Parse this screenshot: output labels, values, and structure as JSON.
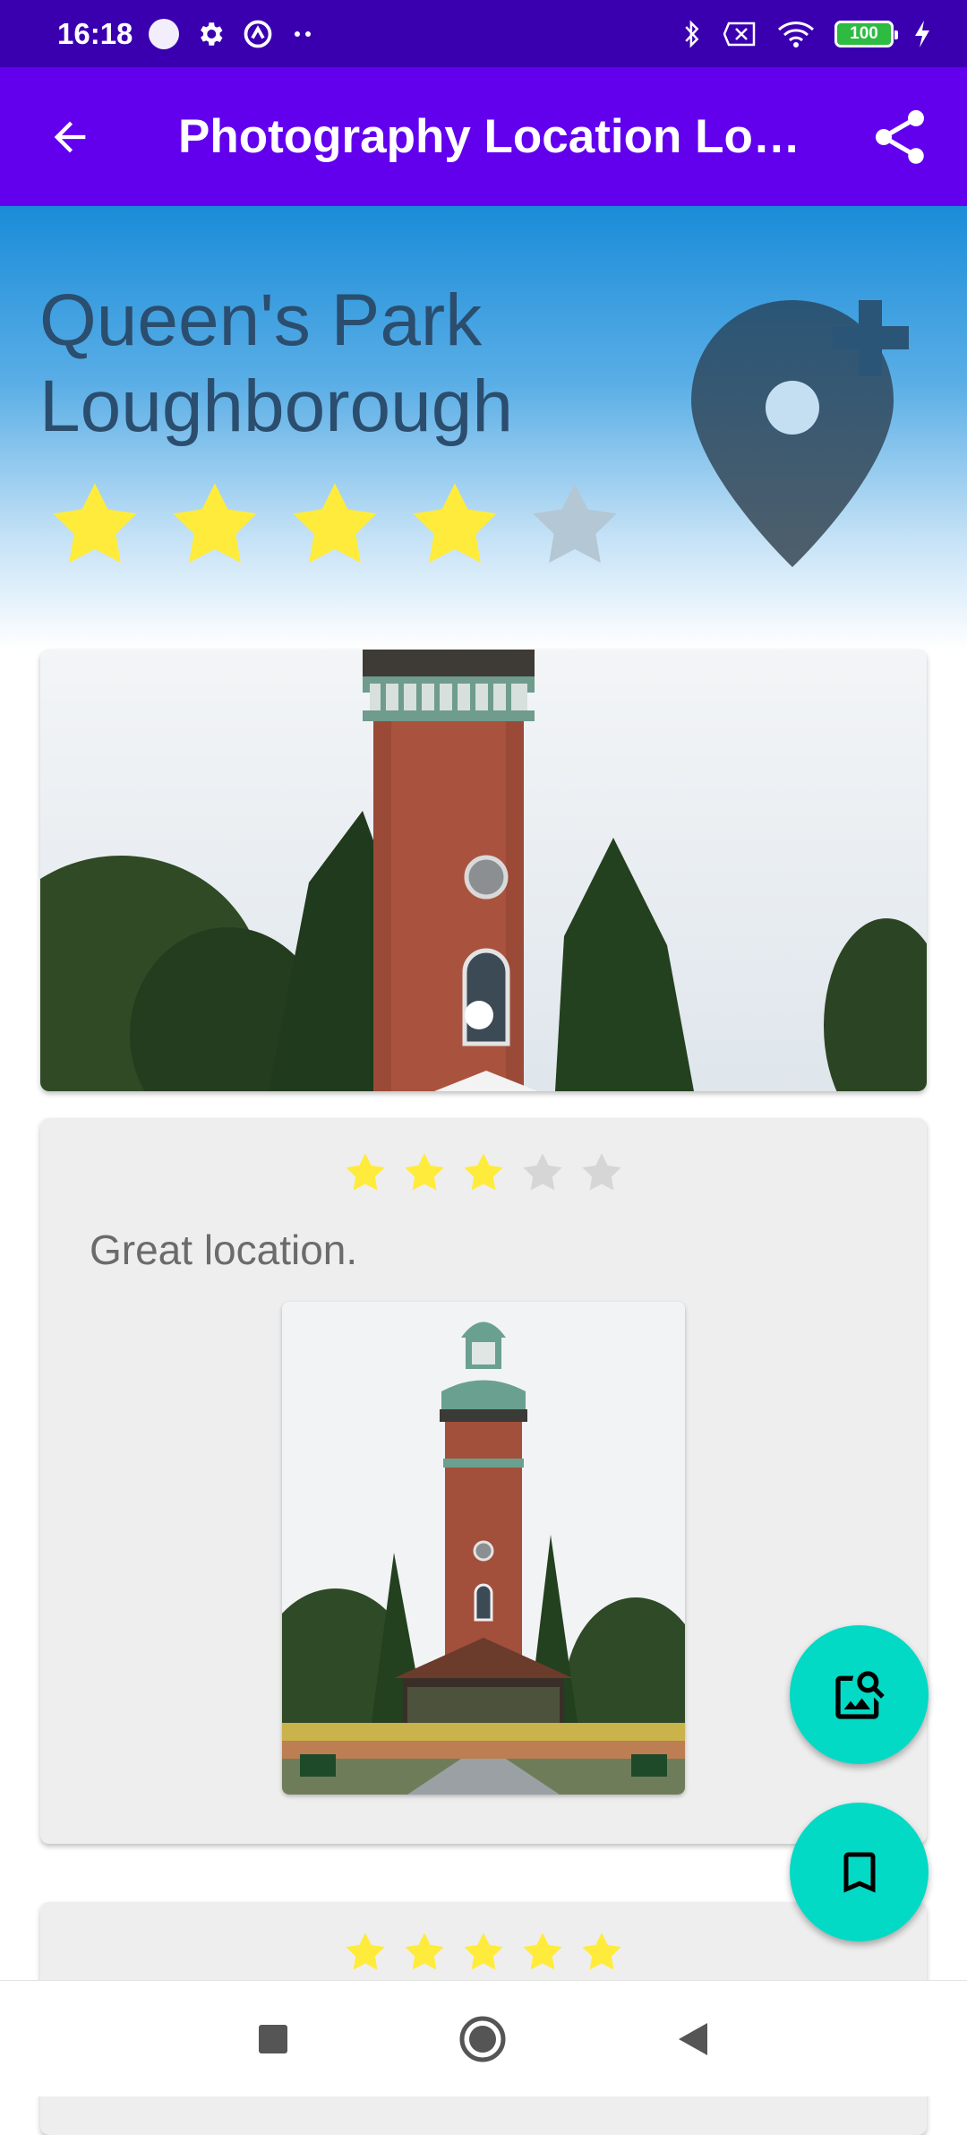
{
  "status_bar": {
    "time": "16:18",
    "battery": "100",
    "icons": [
      "circle-icon",
      "gear-icon",
      "sync-icon",
      "more-dots-icon",
      "bluetooth-icon",
      "no-sim-icon",
      "wifi-icon",
      "battery-icon",
      "charging-icon"
    ]
  },
  "app_bar": {
    "title": "Photography Location Lo…",
    "back_icon": "arrow-back-icon",
    "share_icon": "share-icon"
  },
  "location": {
    "name": "Queen's Park Loughborough",
    "rating": 4,
    "max_rating": 5
  },
  "reviews": [
    {
      "rating": 3,
      "max_rating": 5,
      "text": "Great location."
    },
    {
      "rating": 5,
      "max_rating": 5
    }
  ],
  "fabs": {
    "search_image_icon": "image-search-icon",
    "bookmark_icon": "bookmark-icon"
  },
  "nav_bar": {
    "icons": [
      "recents-square-icon",
      "home-circle-icon",
      "back-triangle-icon"
    ]
  },
  "colors": {
    "status_bar": "#3a00b0",
    "app_bar": "#6200ee",
    "star_filled": "#ffeb3b",
    "star_empty_header": "#b3c7d4",
    "star_empty_card": "#d6d6d6",
    "fab": "#03dac5",
    "pin_icon": "#2b4d6e"
  }
}
